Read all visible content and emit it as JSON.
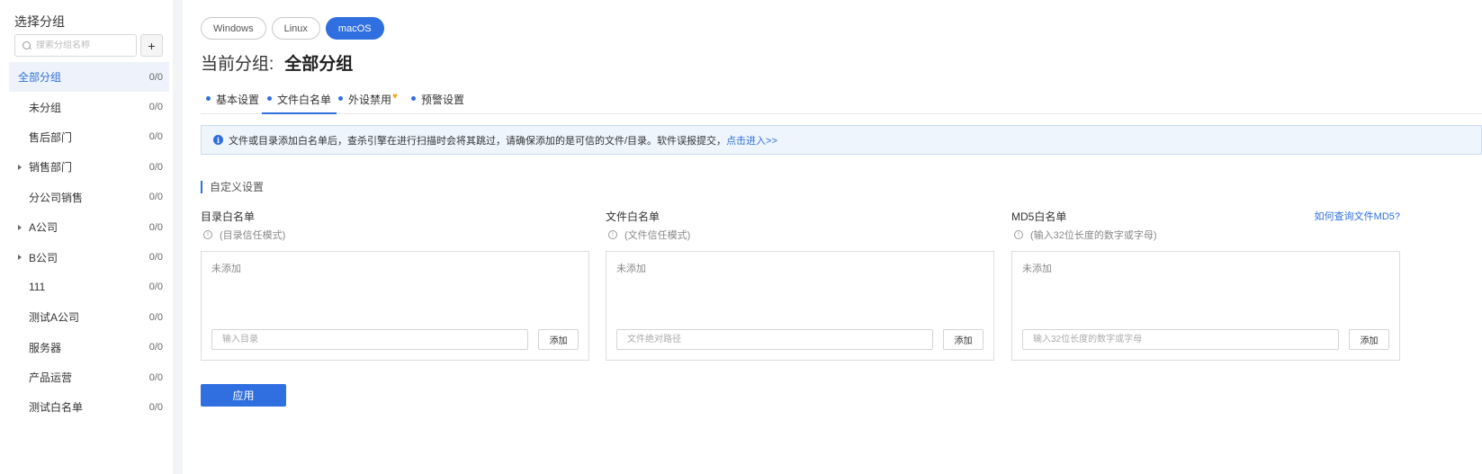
{
  "sidebar": {
    "title": "选择分组",
    "search_placeholder": "搜索分组名称",
    "add_label": "+",
    "groups": [
      {
        "label": "全部分组",
        "count": "0/0"
      },
      {
        "label": "未分组",
        "count": "0/0"
      },
      {
        "label": "售后部门",
        "count": "0/0"
      },
      {
        "label": "销售部门",
        "count": "0/0"
      },
      {
        "label": "分公司销售",
        "count": "0/0"
      },
      {
        "label": "A公司",
        "count": "0/0"
      },
      {
        "label": "B公司",
        "count": "0/0"
      },
      {
        "label": "111",
        "count": "0/0"
      },
      {
        "label": "测试A公司",
        "count": "0/0"
      },
      {
        "label": "服务器",
        "count": "0/0"
      },
      {
        "label": "产品运营",
        "count": "0/0"
      },
      {
        "label": "测试白名单",
        "count": "0/0"
      }
    ]
  },
  "os_tabs": [
    "Windows",
    "Linux",
    "macOS"
  ],
  "header": {
    "current_group_label": "当前分组:",
    "current_group_value": "全部分组"
  },
  "subtabs": {
    "basic": "基本设置",
    "file_whitelist": "文件白名单",
    "device_disable": "外设禁用",
    "alert": "预警设置"
  },
  "notice": {
    "text": "文件或目录添加白名单后，查杀引擎在进行扫描时会将其跳过，请确保添加的是可信的文件/目录。软件误报提交，",
    "link": "点击进入>>"
  },
  "section_title": "自定义设置",
  "panels": {
    "dir": {
      "title": "目录白名单",
      "subtitle": "(目录信任模式)",
      "empty": "未添加",
      "placeholder": "输入目录",
      "add": "添加"
    },
    "file": {
      "title": "文件白名单",
      "subtitle": "(文件信任模式)",
      "empty": "未添加",
      "placeholder": "文件绝对路径",
      "add": "添加"
    },
    "md5": {
      "title": "MD5白名单",
      "subtitle": "(输入32位长度的数字或字母)",
      "help_link": "如何查询文件MD5?",
      "empty": "未添加",
      "placeholder": "输入32位长度的数字或字母",
      "add": "添加"
    }
  },
  "apply_label": "应用",
  "colors": {
    "accent": "#2f6fe0",
    "active_bg": "#eef3fb",
    "notice_bg": "#eef5fd"
  }
}
